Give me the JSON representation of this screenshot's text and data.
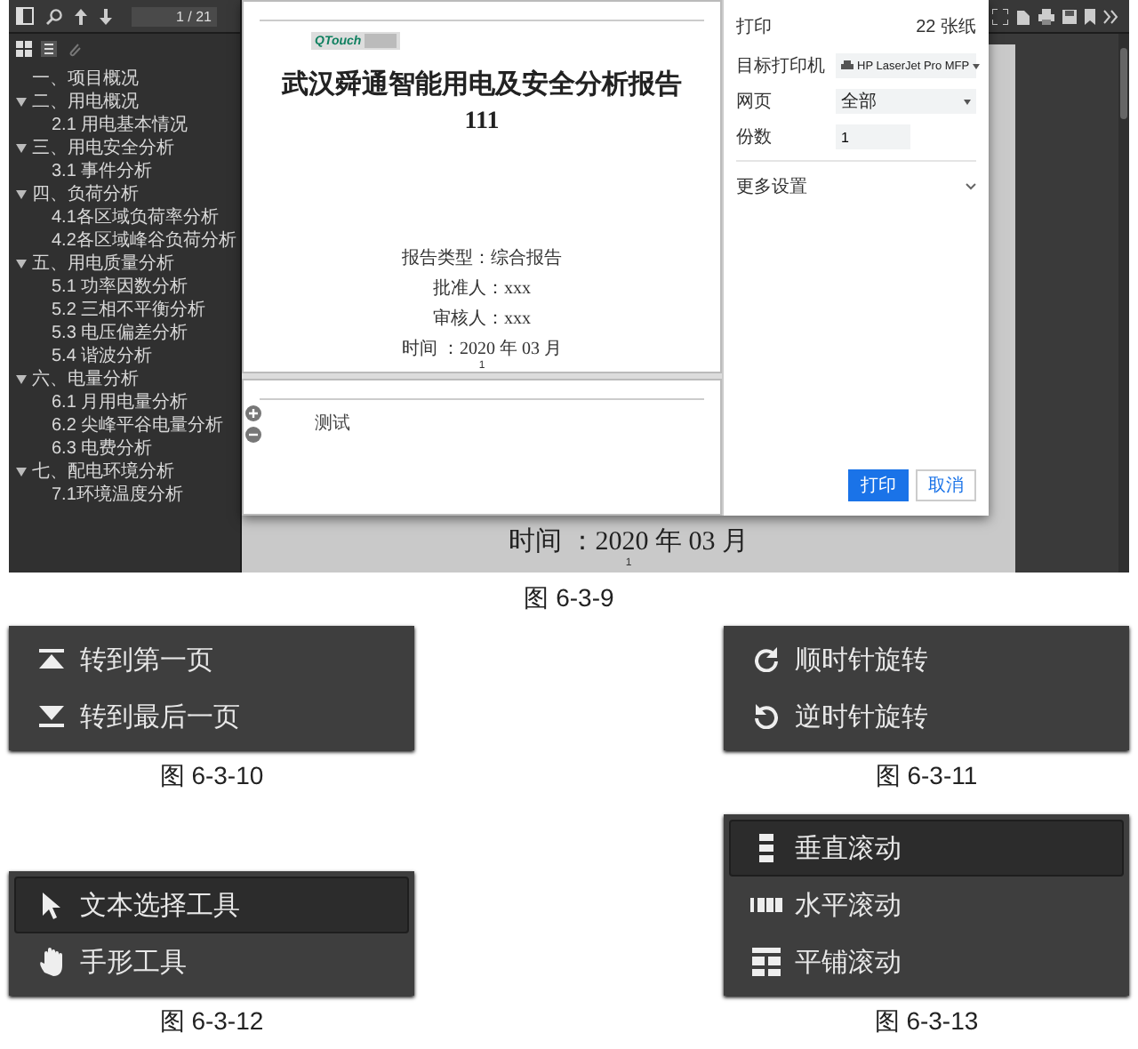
{
  "viewer": {
    "page_field": "1 / 21",
    "outline": [
      {
        "label": "一、项目概况"
      },
      {
        "label": "二、用电概况",
        "expanded": true,
        "children": [
          {
            "label": "2.1 用电基本情况"
          }
        ]
      },
      {
        "label": "三、用电安全分析",
        "expanded": true,
        "children": [
          {
            "label": "3.1 事件分析"
          }
        ]
      },
      {
        "label": "四、负荷分析",
        "expanded": true,
        "children": [
          {
            "label": "4.1各区域负荷率分析"
          },
          {
            "label": "4.2各区域峰谷负荷分析"
          }
        ]
      },
      {
        "label": "五、用电质量分析",
        "expanded": true,
        "children": [
          {
            "label": "5.1 功率因数分析"
          },
          {
            "label": "5.2 三相不平衡分析"
          },
          {
            "label": "5.3 电压偏差分析"
          },
          {
            "label": "5.4 谐波分析"
          }
        ]
      },
      {
        "label": "六、电量分析",
        "expanded": true,
        "children": [
          {
            "label": "6.1 月用电量分析"
          },
          {
            "label": "6.2 尖峰平谷电量分析"
          },
          {
            "label": "6.3 电费分析"
          }
        ]
      },
      {
        "label": "七、配电环境分析",
        "expanded": true,
        "children": [
          {
            "label": "7.1环境温度分析"
          }
        ]
      }
    ],
    "preview": {
      "logo": "QTouch",
      "title": "武汉舜通智能用电及安全分析报告",
      "subtitle": "111",
      "fields": [
        "报告类型：综合报告",
        "批准人：xxx",
        "审核人：xxx",
        "时间 ：2020 年 03 月"
      ],
      "page_number": "1",
      "next_page_heading": "测试"
    },
    "print_dialog": {
      "title": "打印",
      "sheets": "22 张纸",
      "rows": [
        {
          "label": "目标打印机",
          "value": "HP LaserJet Pro MFP",
          "kind": "printer"
        },
        {
          "label": "网页",
          "value": "全部",
          "kind": "select"
        },
        {
          "label": "份数",
          "value": "1",
          "kind": "input"
        }
      ],
      "more_settings": "更多设置",
      "print_button": "打印",
      "cancel_button": "取消"
    },
    "background_page": {
      "date": "时间 ：2020 年 03 月",
      "page_number": "1"
    }
  },
  "viewer_caption": "图 6-3-9",
  "menus": [
    {
      "caption": "图 6-3-10",
      "items": [
        {
          "kind": "first",
          "label": "转到第一页",
          "selected": false
        },
        {
          "kind": "last",
          "label": "转到最后一页",
          "selected": false
        }
      ]
    },
    {
      "caption": "图 6-3-12",
      "items": [
        {
          "kind": "cursor",
          "label": "文本选择工具",
          "selected": true
        },
        {
          "kind": "hand",
          "label": "手形工具",
          "selected": false
        }
      ]
    },
    {
      "caption": "图 6-3-11",
      "items": [
        {
          "kind": "cw",
          "label": "顺时针旋转",
          "selected": false
        },
        {
          "kind": "ccw",
          "label": "逆时针旋转",
          "selected": false
        }
      ]
    },
    {
      "caption": "图 6-3-13",
      "items": [
        {
          "kind": "vertical",
          "label": "垂直滚动",
          "selected": true
        },
        {
          "kind": "horizontal",
          "label": "水平滚动",
          "selected": false
        },
        {
          "kind": "wrapped",
          "label": "平铺滚动",
          "selected": false
        }
      ]
    }
  ]
}
